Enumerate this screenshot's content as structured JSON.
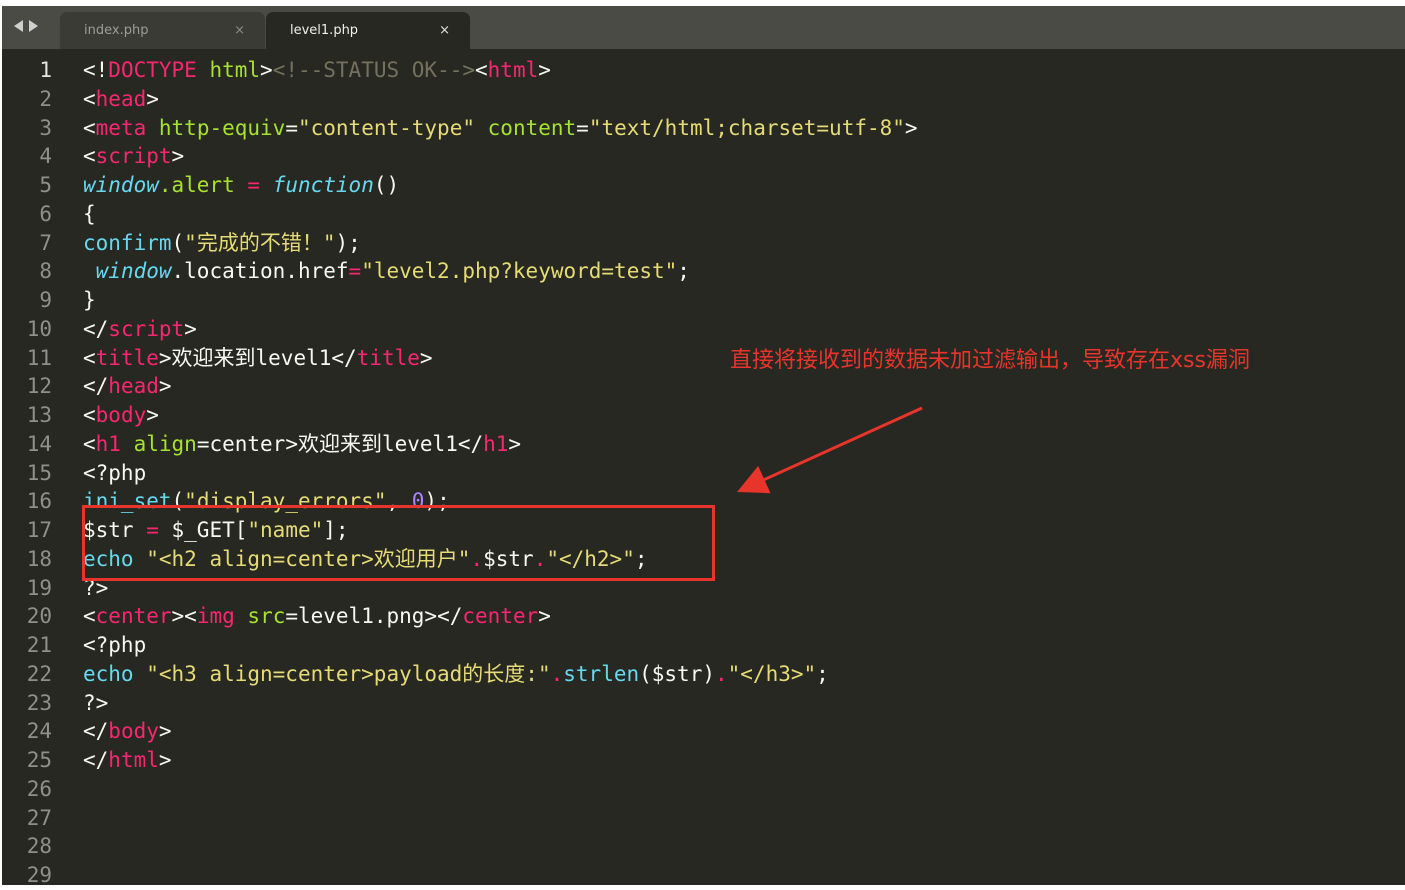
{
  "tabs": [
    {
      "label": "index.php",
      "close": "×"
    },
    {
      "label": "level1.php",
      "close": "×"
    }
  ],
  "annotation": "直接将接收到的数据未加过滤输出，导致存在xss漏洞",
  "colors": {
    "background": "#272822",
    "annotation": "#e8352c",
    "tag": "#f92672",
    "attribute": "#a6e22e",
    "string": "#e6db74",
    "function": "#66d9ef",
    "comment": "#75715e"
  },
  "lines": [
    {
      "n": "1",
      "t": [
        [
          "<!",
          "pl"
        ],
        [
          "DOCTYPE",
          "tag"
        ],
        [
          " ",
          "pl"
        ],
        [
          "html",
          "attr"
        ],
        [
          ">",
          "pl"
        ],
        [
          "<!--STATUS OK-->",
          "cm"
        ],
        [
          "<",
          "pl"
        ],
        [
          "html",
          "tag"
        ],
        [
          ">",
          "pl"
        ]
      ]
    },
    {
      "n": "2",
      "t": [
        [
          "<",
          "pl"
        ],
        [
          "head",
          "tag"
        ],
        [
          ">",
          "pl"
        ]
      ]
    },
    {
      "n": "3",
      "t": [
        [
          "<",
          "pl"
        ],
        [
          "meta",
          "tag"
        ],
        [
          " ",
          "pl"
        ],
        [
          "http-equiv",
          "attr"
        ],
        [
          "=",
          "pl"
        ],
        [
          "\"content-type\"",
          "str"
        ],
        [
          " ",
          "pl"
        ],
        [
          "content",
          "attr"
        ],
        [
          "=",
          "pl"
        ],
        [
          "\"text/html;charset=utf-8\"",
          "str"
        ],
        [
          ">",
          "pl"
        ]
      ]
    },
    {
      "n": "4",
      "t": [
        [
          "<",
          "pl"
        ],
        [
          "script",
          "tag"
        ],
        [
          ">",
          "pl"
        ]
      ]
    },
    {
      "n": "5",
      "t": [
        [
          "window",
          "it"
        ],
        [
          ".alert ",
          "attr"
        ],
        [
          "=",
          "op"
        ],
        [
          " ",
          "pl"
        ],
        [
          "function",
          "it"
        ],
        [
          "()",
          "pl"
        ]
      ]
    },
    {
      "n": "6",
      "t": [
        [
          "{",
          "pl"
        ]
      ]
    },
    {
      "n": "7",
      "t": [
        [
          "confirm",
          "fn"
        ],
        [
          "(",
          "pl"
        ],
        [
          "\"完成的不错！\"",
          "str"
        ],
        [
          ");",
          "pl"
        ]
      ]
    },
    {
      "n": "8",
      "t": [
        [
          " ",
          "pl"
        ],
        [
          "window",
          "it"
        ],
        [
          ".location.href",
          "pl"
        ],
        [
          "=",
          "op"
        ],
        [
          "\"level2.php?keyword=test\"",
          "str"
        ],
        [
          ";",
          "pl"
        ]
      ]
    },
    {
      "n": "9",
      "t": [
        [
          "}",
          "pl"
        ]
      ]
    },
    {
      "n": "10",
      "t": [
        [
          "</",
          "pl"
        ],
        [
          "script",
          "tag"
        ],
        [
          ">",
          "pl"
        ]
      ]
    },
    {
      "n": "11",
      "t": [
        [
          "<",
          "pl"
        ],
        [
          "title",
          "tag"
        ],
        [
          ">欢迎来到level1</",
          "pl"
        ],
        [
          "title",
          "tag"
        ],
        [
          ">",
          "pl"
        ]
      ]
    },
    {
      "n": "12",
      "t": [
        [
          "</",
          "pl"
        ],
        [
          "head",
          "tag"
        ],
        [
          ">",
          "pl"
        ]
      ]
    },
    {
      "n": "13",
      "t": [
        [
          "<",
          "pl"
        ],
        [
          "body",
          "tag"
        ],
        [
          ">",
          "pl"
        ]
      ]
    },
    {
      "n": "14",
      "t": [
        [
          "<",
          "pl"
        ],
        [
          "h1",
          "tag"
        ],
        [
          " ",
          "pl"
        ],
        [
          "align",
          "attr"
        ],
        [
          "=center>欢迎来到level1</",
          "pl"
        ],
        [
          "h1",
          "tag"
        ],
        [
          ">",
          "pl"
        ]
      ]
    },
    {
      "n": "15",
      "t": [
        [
          "<?php",
          "pl"
        ]
      ]
    },
    {
      "n": "16",
      "t": [
        [
          "ini_set",
          "fn"
        ],
        [
          "(",
          "pl"
        ],
        [
          "\"display_errors\"",
          "str"
        ],
        [
          ", ",
          "pl"
        ],
        [
          "0",
          "num"
        ],
        [
          ");",
          "pl"
        ]
      ]
    },
    {
      "n": "17",
      "t": [
        [
          "$str ",
          "pl"
        ],
        [
          "=",
          "op"
        ],
        [
          " $_GET[",
          "pl"
        ],
        [
          "\"name\"",
          "str"
        ],
        [
          "];",
          "pl"
        ]
      ]
    },
    {
      "n": "18",
      "t": [
        [
          "echo",
          "fn"
        ],
        [
          " ",
          "pl"
        ],
        [
          "\"<h2 align=center>欢迎用户\"",
          "str"
        ],
        [
          ".",
          "op"
        ],
        [
          "$str",
          "pl"
        ],
        [
          ".",
          "op"
        ],
        [
          "\"</h2>\"",
          "str"
        ],
        [
          ";",
          "pl"
        ]
      ]
    },
    {
      "n": "19",
      "t": [
        [
          "?>",
          "pl"
        ]
      ]
    },
    {
      "n": "20",
      "t": [
        [
          "<",
          "pl"
        ],
        [
          "center",
          "tag"
        ],
        [
          ">",
          "pl"
        ],
        [
          "<",
          "pl"
        ],
        [
          "img",
          "tag"
        ],
        [
          " ",
          "pl"
        ],
        [
          "src",
          "attr"
        ],
        [
          "=level1.png></",
          "pl"
        ],
        [
          "center",
          "tag"
        ],
        [
          ">",
          "pl"
        ]
      ]
    },
    {
      "n": "21",
      "t": [
        [
          "<?php",
          "pl"
        ]
      ]
    },
    {
      "n": "22",
      "t": [
        [
          "echo",
          "fn"
        ],
        [
          " ",
          "pl"
        ],
        [
          "\"<h3 align=center>payload的长度:\"",
          "str"
        ],
        [
          ".",
          "op"
        ],
        [
          "strlen",
          "fn"
        ],
        [
          "($str)",
          "pl"
        ],
        [
          ".",
          "op"
        ],
        [
          "\"</h3>\"",
          "str"
        ],
        [
          ";",
          "pl"
        ]
      ]
    },
    {
      "n": "23",
      "t": [
        [
          "?>",
          "pl"
        ]
      ]
    },
    {
      "n": "24",
      "t": [
        [
          "</",
          "pl"
        ],
        [
          "body",
          "tag"
        ],
        [
          ">",
          "pl"
        ]
      ]
    },
    {
      "n": "25",
      "t": [
        [
          "</",
          "pl"
        ],
        [
          "html",
          "tag"
        ],
        [
          ">",
          "pl"
        ]
      ]
    },
    {
      "n": "26",
      "t": []
    },
    {
      "n": "27",
      "t": []
    },
    {
      "n": "28",
      "t": []
    },
    {
      "n": "29",
      "t": []
    }
  ]
}
